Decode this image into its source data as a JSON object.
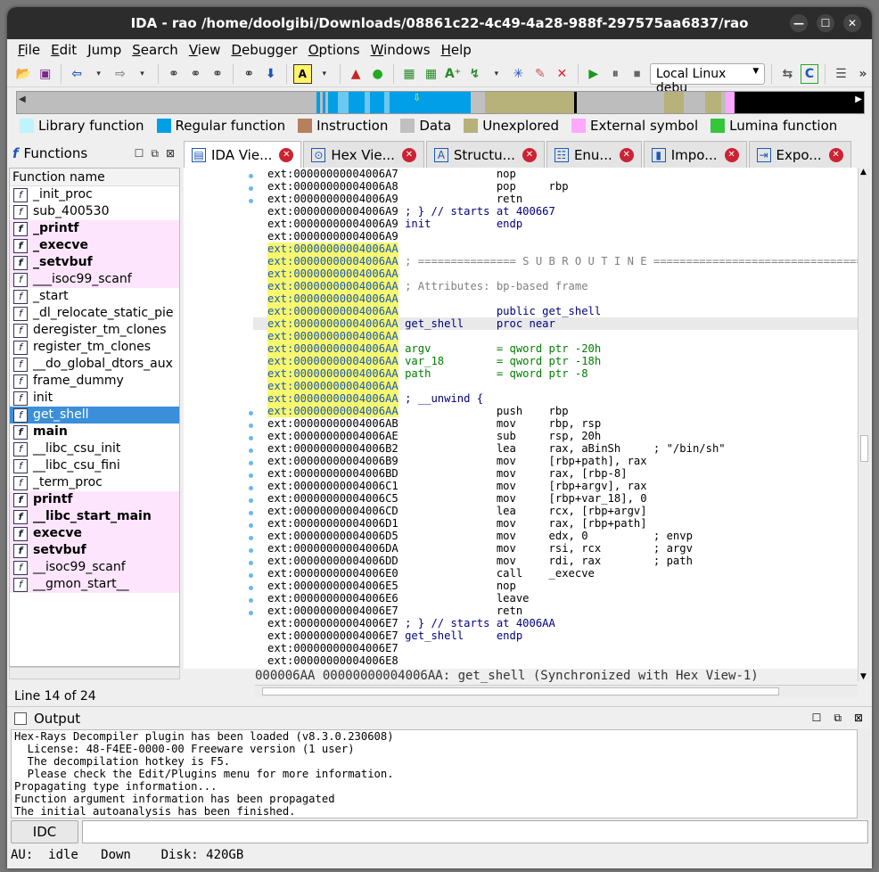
{
  "window": {
    "title": "IDA - rao /home/doolgibi/Downloads/08861c22-4c49-4a28-988f-297575aa6837/rao"
  },
  "menu": [
    "File",
    "Edit",
    "Jump",
    "Search",
    "View",
    "Debugger",
    "Options",
    "Windows",
    "Help"
  ],
  "toolbar": {
    "debugger_select": "Local Linux debu"
  },
  "legend": [
    {
      "label": "Library function",
      "color": "#bff4ff"
    },
    {
      "label": "Regular function",
      "color": "#009fe8"
    },
    {
      "label": "Instruction",
      "color": "#b67f5e"
    },
    {
      "label": "Data",
      "color": "#c0c0c0"
    },
    {
      "label": "Unexplored",
      "color": "#b7b17a"
    },
    {
      "label": "External symbol",
      "color": "#ffa8ff"
    },
    {
      "label": "Lumina function",
      "color": "#36c63b"
    }
  ],
  "functions_pane": {
    "title": "Functions",
    "header": "Function name",
    "items": [
      {
        "name": "_init_proc",
        "style": ""
      },
      {
        "name": "sub_400530",
        "style": ""
      },
      {
        "name": "_printf",
        "style": "lib bold"
      },
      {
        "name": "_execve",
        "style": "lib bold"
      },
      {
        "name": "_setvbuf",
        "style": "lib bold"
      },
      {
        "name": "___isoc99_scanf",
        "style": "lib"
      },
      {
        "name": "_start",
        "style": ""
      },
      {
        "name": "_dl_relocate_static_pie",
        "style": ""
      },
      {
        "name": "deregister_tm_clones",
        "style": ""
      },
      {
        "name": "register_tm_clones",
        "style": ""
      },
      {
        "name": "__do_global_dtors_aux",
        "style": ""
      },
      {
        "name": "frame_dummy",
        "style": ""
      },
      {
        "name": "init",
        "style": ""
      },
      {
        "name": "get_shell",
        "style": "sel"
      },
      {
        "name": "main",
        "style": "bold"
      },
      {
        "name": "__libc_csu_init",
        "style": ""
      },
      {
        "name": "__libc_csu_fini",
        "style": ""
      },
      {
        "name": "_term_proc",
        "style": ""
      },
      {
        "name": "printf",
        "style": "lib bold"
      },
      {
        "name": "__libc_start_main",
        "style": "lib bold"
      },
      {
        "name": "execve",
        "style": "lib bold"
      },
      {
        "name": "setvbuf",
        "style": "lib bold"
      },
      {
        "name": "__isoc99_scanf",
        "style": "lib"
      },
      {
        "name": "__gmon_start__",
        "style": "lib"
      }
    ],
    "line_info": "Line 14 of 24"
  },
  "tabs": [
    {
      "label": "IDA Vie...",
      "icon": "ida-view-icon",
      "glyph": "▤",
      "active": true
    },
    {
      "label": "Hex Vie...",
      "icon": "hex-view-icon",
      "glyph": "⊙",
      "active": false
    },
    {
      "label": "Structu...",
      "icon": "structures-icon",
      "glyph": "A",
      "active": false
    },
    {
      "label": "Enu...",
      "icon": "enums-icon",
      "glyph": "☷",
      "active": false
    },
    {
      "label": "Impo...",
      "icon": "imports-icon",
      "glyph": "▮",
      "active": false
    },
    {
      "label": "Expo...",
      "icon": "exports-icon",
      "glyph": "⇥",
      "active": false
    }
  ],
  "disasm": [
    {
      "addr": "ext:00000000004006A7",
      "hl": false,
      "code": "              nop"
    },
    {
      "addr": "ext:00000000004006A8",
      "hl": false,
      "code": "              pop     rbp"
    },
    {
      "addr": "ext:00000000004006A9",
      "hl": false,
      "code": "              retn"
    },
    {
      "addr": "ext:00000000004006A9",
      "hl": false,
      "code": "; } // starts at 400667",
      "cls": "kw"
    },
    {
      "addr": "ext:00000000004006A9",
      "hl": false,
      "code": "init          endp",
      "cls": "kw"
    },
    {
      "addr": "ext:00000000004006A9",
      "hl": false,
      "code": ""
    },
    {
      "addr": "ext:00000000004006AA",
      "hl": true,
      "code": ""
    },
    {
      "addr": "ext:00000000004006AA",
      "hl": true,
      "code": "; =============== S U B R O U T I N E =======================================",
      "cls": "cm"
    },
    {
      "addr": "ext:00000000004006AA",
      "hl": true,
      "code": ""
    },
    {
      "addr": "ext:00000000004006AA",
      "hl": true,
      "code": "; Attributes: bp-based frame",
      "cls": "cm"
    },
    {
      "addr": "ext:00000000004006AA",
      "hl": true,
      "code": ""
    },
    {
      "addr": "ext:00000000004006AA",
      "hl": true,
      "code": "              public get_shell",
      "cls": "kw"
    },
    {
      "addr": "ext:00000000004006AA",
      "hl": true,
      "code": "get_shell     proc near",
      "cls": "kw",
      "cur": true
    },
    {
      "addr": "ext:00000000004006AA",
      "hl": true,
      "code": ""
    },
    {
      "addr": "ext:00000000004006AA",
      "hl": true,
      "code": "argv          = qword ptr -20h",
      "cls": "gn"
    },
    {
      "addr": "ext:00000000004006AA",
      "hl": true,
      "code": "var_18        = qword ptr -18h",
      "cls": "gn"
    },
    {
      "addr": "ext:00000000004006AA",
      "hl": true,
      "code": "path          = qword ptr -8",
      "cls": "gn"
    },
    {
      "addr": "ext:00000000004006AA",
      "hl": true,
      "code": ""
    },
    {
      "addr": "ext:00000000004006AA",
      "hl": true,
      "code": "; __unwind {",
      "cls": "kw"
    },
    {
      "addr": "ext:00000000004006AA",
      "hl": true,
      "code": "              push    rbp"
    },
    {
      "addr": "ext:00000000004006AB",
      "hl": false,
      "code": "              mov     rbp, rsp"
    },
    {
      "addr": "ext:00000000004006AE",
      "hl": false,
      "code": "              sub     rsp, 20h"
    },
    {
      "addr": "ext:00000000004006B2",
      "hl": false,
      "code": "              lea     rax, aBinSh     ; \"/bin/sh\""
    },
    {
      "addr": "ext:00000000004006B9",
      "hl": false,
      "code": "              mov     [rbp+path], rax"
    },
    {
      "addr": "ext:00000000004006BD",
      "hl": false,
      "code": "              mov     rax, [rbp-8]"
    },
    {
      "addr": "ext:00000000004006C1",
      "hl": false,
      "code": "              mov     [rbp+argv], rax"
    },
    {
      "addr": "ext:00000000004006C5",
      "hl": false,
      "code": "              mov     [rbp+var_18], 0"
    },
    {
      "addr": "ext:00000000004006CD",
      "hl": false,
      "code": "              lea     rcx, [rbp+argv]"
    },
    {
      "addr": "ext:00000000004006D1",
      "hl": false,
      "code": "              mov     rax, [rbp+path]"
    },
    {
      "addr": "ext:00000000004006D5",
      "hl": false,
      "code": "              mov     edx, 0          ; envp"
    },
    {
      "addr": "ext:00000000004006DA",
      "hl": false,
      "code": "              mov     rsi, rcx        ; argv"
    },
    {
      "addr": "ext:00000000004006DD",
      "hl": false,
      "code": "              mov     rdi, rax        ; path"
    },
    {
      "addr": "ext:00000000004006E0",
      "hl": false,
      "code": "              call    _execve"
    },
    {
      "addr": "ext:00000000004006E5",
      "hl": false,
      "code": "              nop"
    },
    {
      "addr": "ext:00000000004006E6",
      "hl": false,
      "code": "              leave"
    },
    {
      "addr": "ext:00000000004006E7",
      "hl": false,
      "code": "              retn"
    },
    {
      "addr": "ext:00000000004006E7",
      "hl": false,
      "code": "; } // starts at 4006AA",
      "cls": "kw"
    },
    {
      "addr": "ext:00000000004006E7",
      "hl": false,
      "code": "get_shell     endp",
      "cls": "kw"
    },
    {
      "addr": "ext:00000000004006E7",
      "hl": false,
      "code": ""
    },
    {
      "addr": "ext:00000000004006E8",
      "hl": false,
      "code": ""
    }
  ],
  "disasm_status": "000006AA 00000000004006AA: get_shell (Synchronized with Hex View-1)",
  "output": {
    "title": "Output",
    "lines": [
      "Hex-Rays Decompiler plugin has been loaded (v8.3.0.230608)",
      "  License: 48-F4EE-0000-00 Freeware version (1 user)",
      "  The decompilation hotkey is F5.",
      "  Please check the Edit/Plugins menu for more information.",
      "Propagating type information...",
      "Function argument information has been propagated",
      "The initial autoanalysis has been finished."
    ]
  },
  "idc_button": "IDC",
  "status_bar": "AU:  idle   Down    Disk: 420GB"
}
